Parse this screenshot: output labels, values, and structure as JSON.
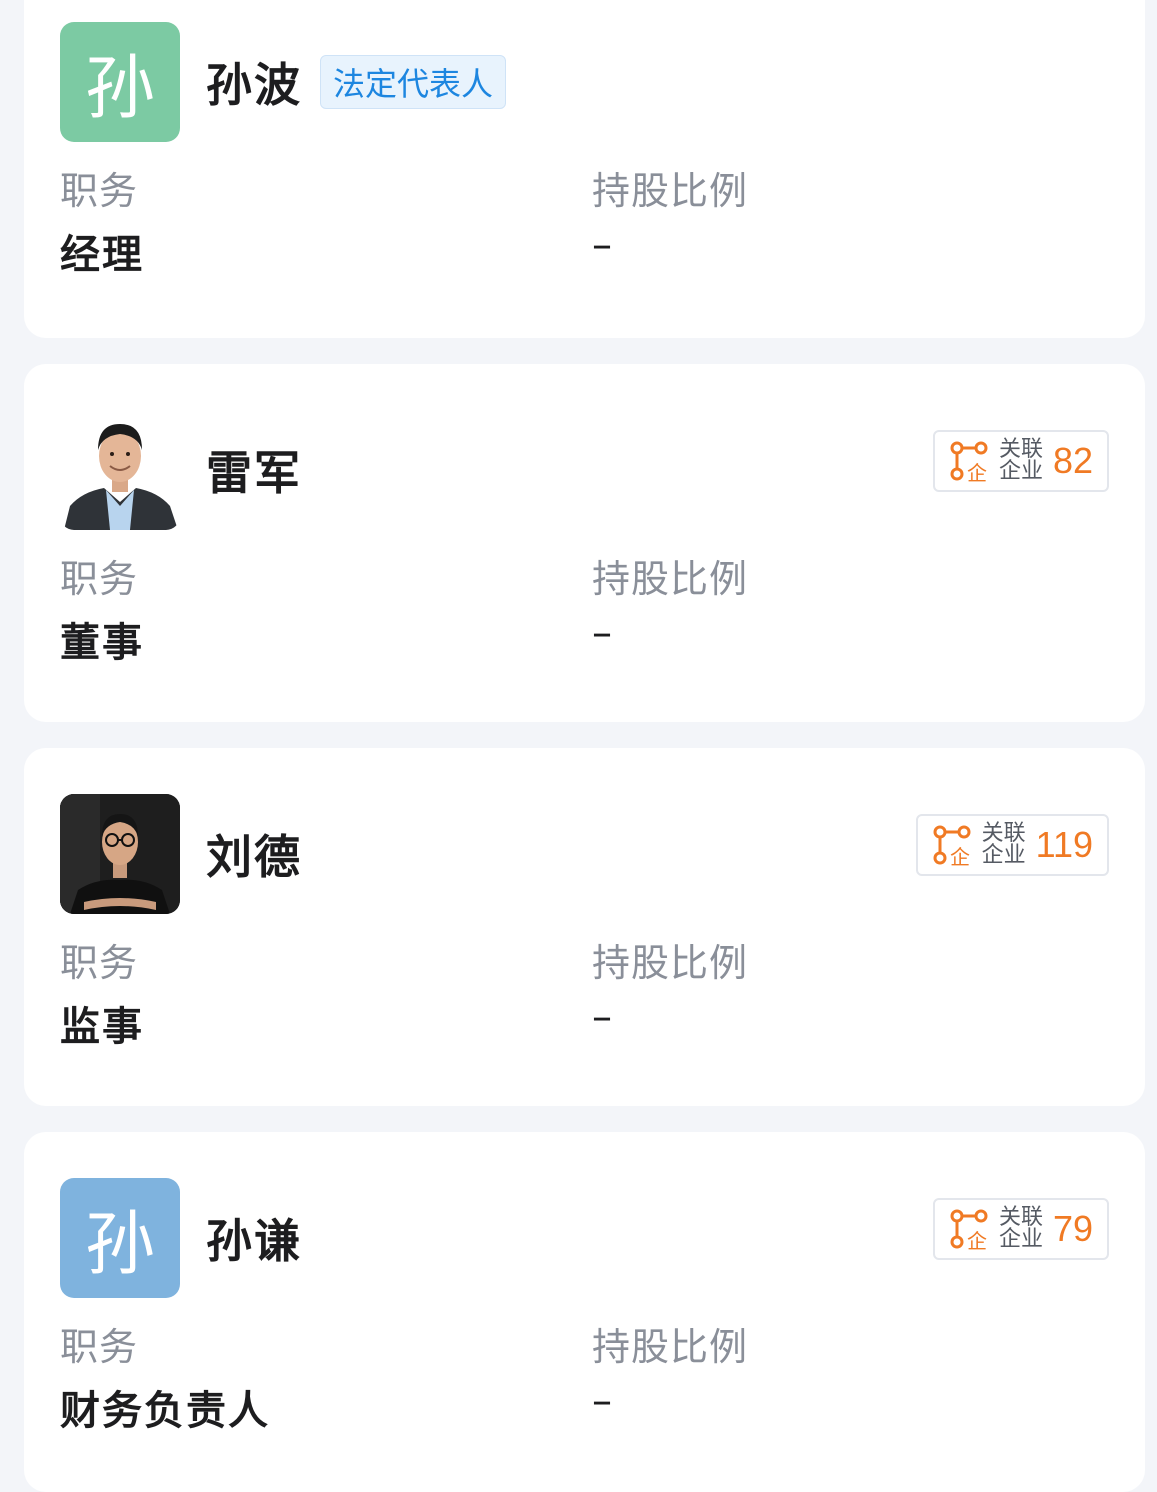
{
  "people": [
    {
      "name": "孙波",
      "avatar_char": "孙",
      "avatar_color": "#7ccaa3",
      "tag": "法定代表人",
      "position_label": "职务",
      "position": "经理",
      "share_label": "持股比例",
      "share": "–"
    },
    {
      "name": "雷军",
      "avatar_kind": "photo",
      "assoc_label_1": "关联",
      "assoc_label_2": "企业",
      "assoc_count": "82",
      "position_label": "职务",
      "position": "董事",
      "share_label": "持股比例",
      "share": "–"
    },
    {
      "name": "刘德",
      "avatar_kind": "photo",
      "assoc_label_1": "关联",
      "assoc_label_2": "企业",
      "assoc_count": "119",
      "position_label": "职务",
      "position": "监事",
      "share_label": "持股比例",
      "share": "–"
    },
    {
      "name": "孙谦",
      "avatar_char": "孙",
      "avatar_color": "#7fb3de",
      "assoc_label_1": "关联",
      "assoc_label_2": "企业",
      "assoc_count": "79",
      "position_label": "职务",
      "position": "财务负责人",
      "share_label": "持股比例",
      "share": "–"
    }
  ],
  "colors": {
    "accent_orange": "#f07a24",
    "tag_blue": "#1d86e0",
    "label_gray": "#8a8f99"
  },
  "icons": {
    "assoc": "related-company-icon"
  }
}
